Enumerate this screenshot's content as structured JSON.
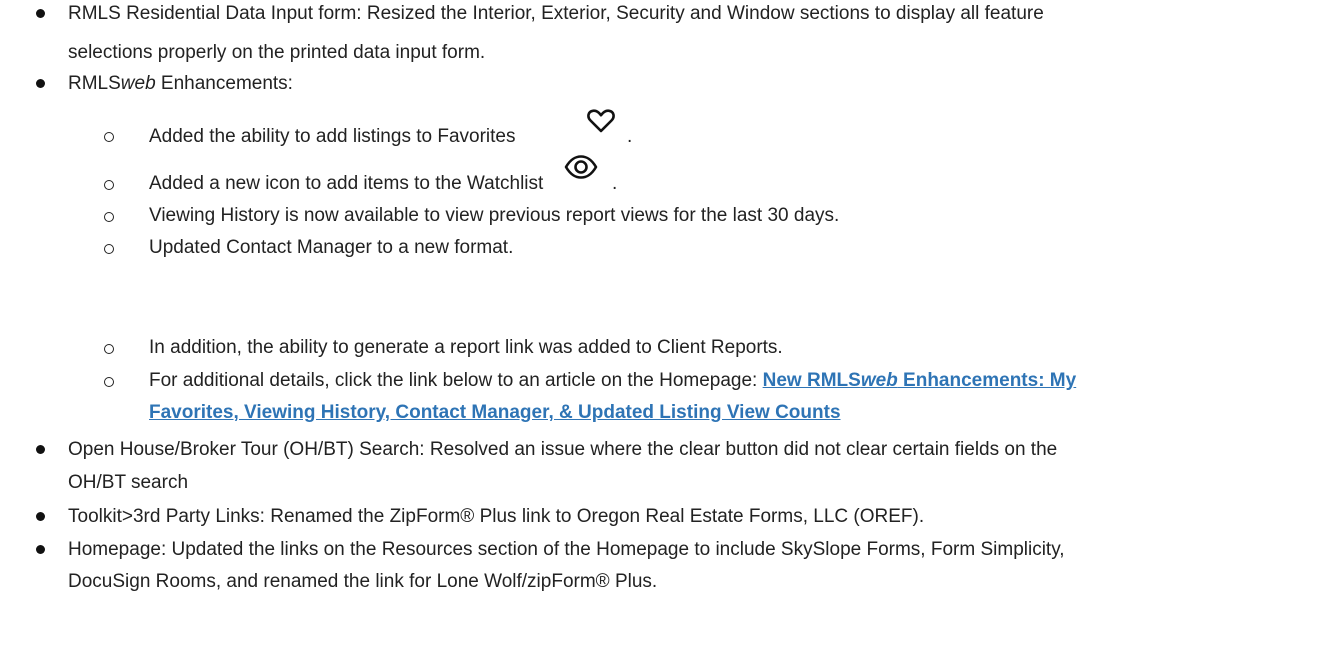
{
  "items": {
    "b1_l1": "RMLS Residential Data Input form: Resized the Interior, Exterior, Security and Window sections to display all feature",
    "b1_l2": "selections properly on the printed data input form.",
    "b2_a": "RMLS",
    "b2_b": "web",
    "b2_c": " Enhancements:",
    "s1": "Added the ability to add listings to Favorites",
    "s1_end": ".",
    "s2": "Added a new icon to add items to the Watchlist",
    "s2_end": ".",
    "s3": "Viewing History is now available to view previous report views for the last 30 days.",
    "s4": "Updated Contact Manager to a new format.",
    "s5": "In addition, the ability to generate a report link was added to Client Reports.",
    "s6": "For additional details, click the link below to an article on the Homepage: ",
    "link_a": "New RMLS",
    "link_b": "web",
    "link_c": " Enhancements: My",
    "link_l2": "Favorites, Viewing History, Contact Manager, & Updated Listing View Counts",
    "b3_l1": "Open House/Broker Tour (OH/BT) Search: Resolved an issue where the clear button did not clear certain fields on the",
    "b3_l2": "OH/BT search",
    "b4": "Toolkit>3rd Party Links: Renamed the ZipForm® Plus link to Oregon Real Estate Forms, LLC (OREF).",
    "b5_l1": "Homepage:  Updated the links on the Resources section of the Homepage to include SkySlope Forms, Form Simplicity,",
    "b5_l2": "DocuSign Rooms, and renamed the link for Lone Wolf/zipForm® Plus."
  },
  "icons": [
    "heart-icon",
    "eye-icon"
  ]
}
